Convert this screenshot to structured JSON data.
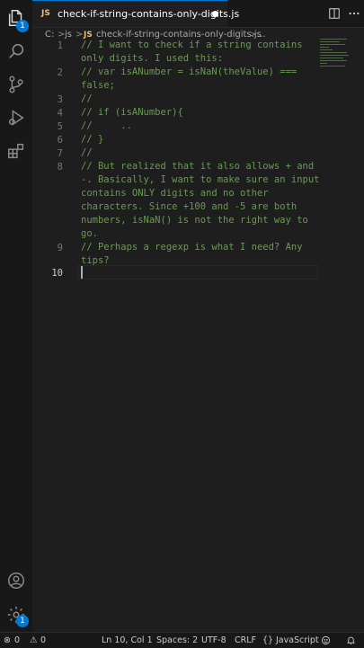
{
  "tab": {
    "title": "check-if-string-contains-only-digits.js",
    "lang_badge": "JS"
  },
  "breadcrumb": {
    "drive": "C:",
    "sep1": ">",
    "folder": "js",
    "sep2": ">",
    "badge": "JS",
    "file": "check-if-string-contains-only-digits.js",
    "sep3": ">",
    "more": "..."
  },
  "editor": {
    "lines": [
      {
        "num": "1",
        "text": "// I want to check if a string contains"
      },
      {
        "num": "",
        "text": "only digits. I used this:"
      },
      {
        "num": "2",
        "text": "// var isANumber = isNaN(theValue) ==="
      },
      {
        "num": "",
        "text": "false;"
      },
      {
        "num": "3",
        "text": "//"
      },
      {
        "num": "4",
        "text": "// if (isANumber){"
      },
      {
        "num": "5",
        "text": "//     .."
      },
      {
        "num": "6",
        "text": "// }"
      },
      {
        "num": "7",
        "text": "//"
      },
      {
        "num": "8",
        "text": "// But realized that it also allows + and"
      },
      {
        "num": "",
        "text": "-. Basically, I want to make sure an input"
      },
      {
        "num": "",
        "text": "contains ONLY digits and no other"
      },
      {
        "num": "",
        "text": "characters. Since +100 and -5 are both"
      },
      {
        "num": "",
        "text": "numbers, isNaN() is not the right way to"
      },
      {
        "num": "",
        "text": "go."
      },
      {
        "num": "9",
        "text": "// Perhaps a regexp is what I need? Any"
      },
      {
        "num": "",
        "text": "tips?"
      },
      {
        "num": "10",
        "text": ""
      }
    ]
  },
  "activity": {
    "extensions_badge": "",
    "settings_badge": "1",
    "explorer_badge": "1"
  },
  "status": {
    "errors": "0",
    "warnings": "0",
    "position": "Ln 10, Col 1",
    "spaces": "Spaces: 2",
    "encoding": "UTF-8",
    "eol": "CRLF",
    "language_braces": "{}",
    "language": "JavaScript"
  },
  "colors": {
    "comment": "#6a9955",
    "accent": "#0078d4",
    "js_badge": "#e5c07b"
  }
}
